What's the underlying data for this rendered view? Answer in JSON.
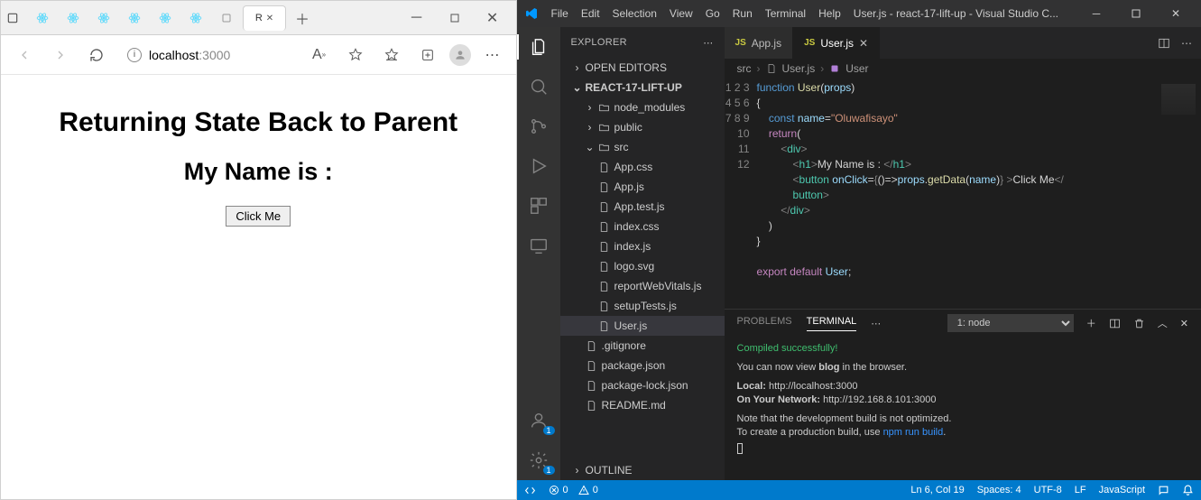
{
  "browser": {
    "url_host": "localhost",
    "url_port": ":3000",
    "tabs_count": 8,
    "new_tab_tooltip": "New tab"
  },
  "page": {
    "heading": "Returning State Back to Parent",
    "subheading": "My Name is :",
    "button_label": "Click Me"
  },
  "vscode": {
    "menus": [
      "File",
      "Edit",
      "Selection",
      "View",
      "Go",
      "Run",
      "Terminal",
      "Help"
    ],
    "window_title": "User.js - react-17-lift-up - Visual Studio C...",
    "explorer": {
      "title": "EXPLORER",
      "open_editors": "OPEN EDITORS",
      "project": "REACT-17-LIFT-UP",
      "outline": "OUTLINE",
      "tree": {
        "node_modules": "node_modules",
        "public": "public",
        "src": "src",
        "files": [
          "App.css",
          "App.js",
          "App.test.js",
          "index.css",
          "index.js",
          "logo.svg",
          "reportWebVitals.js",
          "setupTests.js",
          "User.js"
        ],
        "root_files": [
          ".gitignore",
          "package.json",
          "package-lock.json",
          "README.md"
        ]
      }
    },
    "tabs": {
      "inactive": "App.js",
      "active": "User.js"
    },
    "breadcrumb": {
      "a": "src",
      "b": "User.js",
      "c": "User"
    },
    "code_lines": 12,
    "panel": {
      "problems": "PROBLEMS",
      "terminal": "TERMINAL",
      "shell": "1: node",
      "line1": "Compiled successfully!",
      "line2a": "You can now view ",
      "line2b": "blog",
      "line2c": " in the browser.",
      "local_lbl": "Local:",
      "local_url": "http://localhost:3000",
      "net_lbl": "On Your Network:",
      "net_url": "http://192.168.8.101:3000",
      "note1": "Note that the development build is not optimized.",
      "note2a": "To create a production build, use ",
      "note2b": "npm run build",
      "note2c": "."
    },
    "status": {
      "errors": "0",
      "warnings": "0",
      "cursor": "Ln 6, Col 19",
      "spaces": "Spaces: 4",
      "encoding": "UTF-8",
      "eol": "LF",
      "lang": "JavaScript"
    }
  }
}
